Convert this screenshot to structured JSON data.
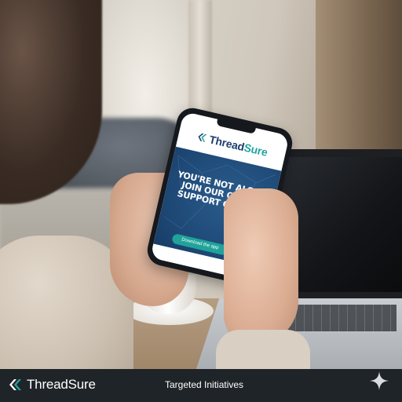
{
  "phone_app": {
    "brand_prefix": "Thread",
    "brand_suffix": "Sure",
    "headline_line1": "YOU'RE NOT ALONE.",
    "headline_line2": "JOIN OUR ONLINE",
    "headline_line3": "SUPPORT GROUPS",
    "cta_label": "Download the app",
    "logo_icon": "threadsure-logo-icon"
  },
  "footer_bar": {
    "brand": "ThreadSure",
    "tagline": "Targeted Initiatives",
    "logo_icon": "threadsure-logo-icon",
    "corner_icon": "sparkle-icon"
  },
  "colors": {
    "brand_navy": "#1e3f6e",
    "brand_teal": "#23a4a0",
    "footer_bg": "#1f2428",
    "cta_bg": "#1fa39a"
  }
}
